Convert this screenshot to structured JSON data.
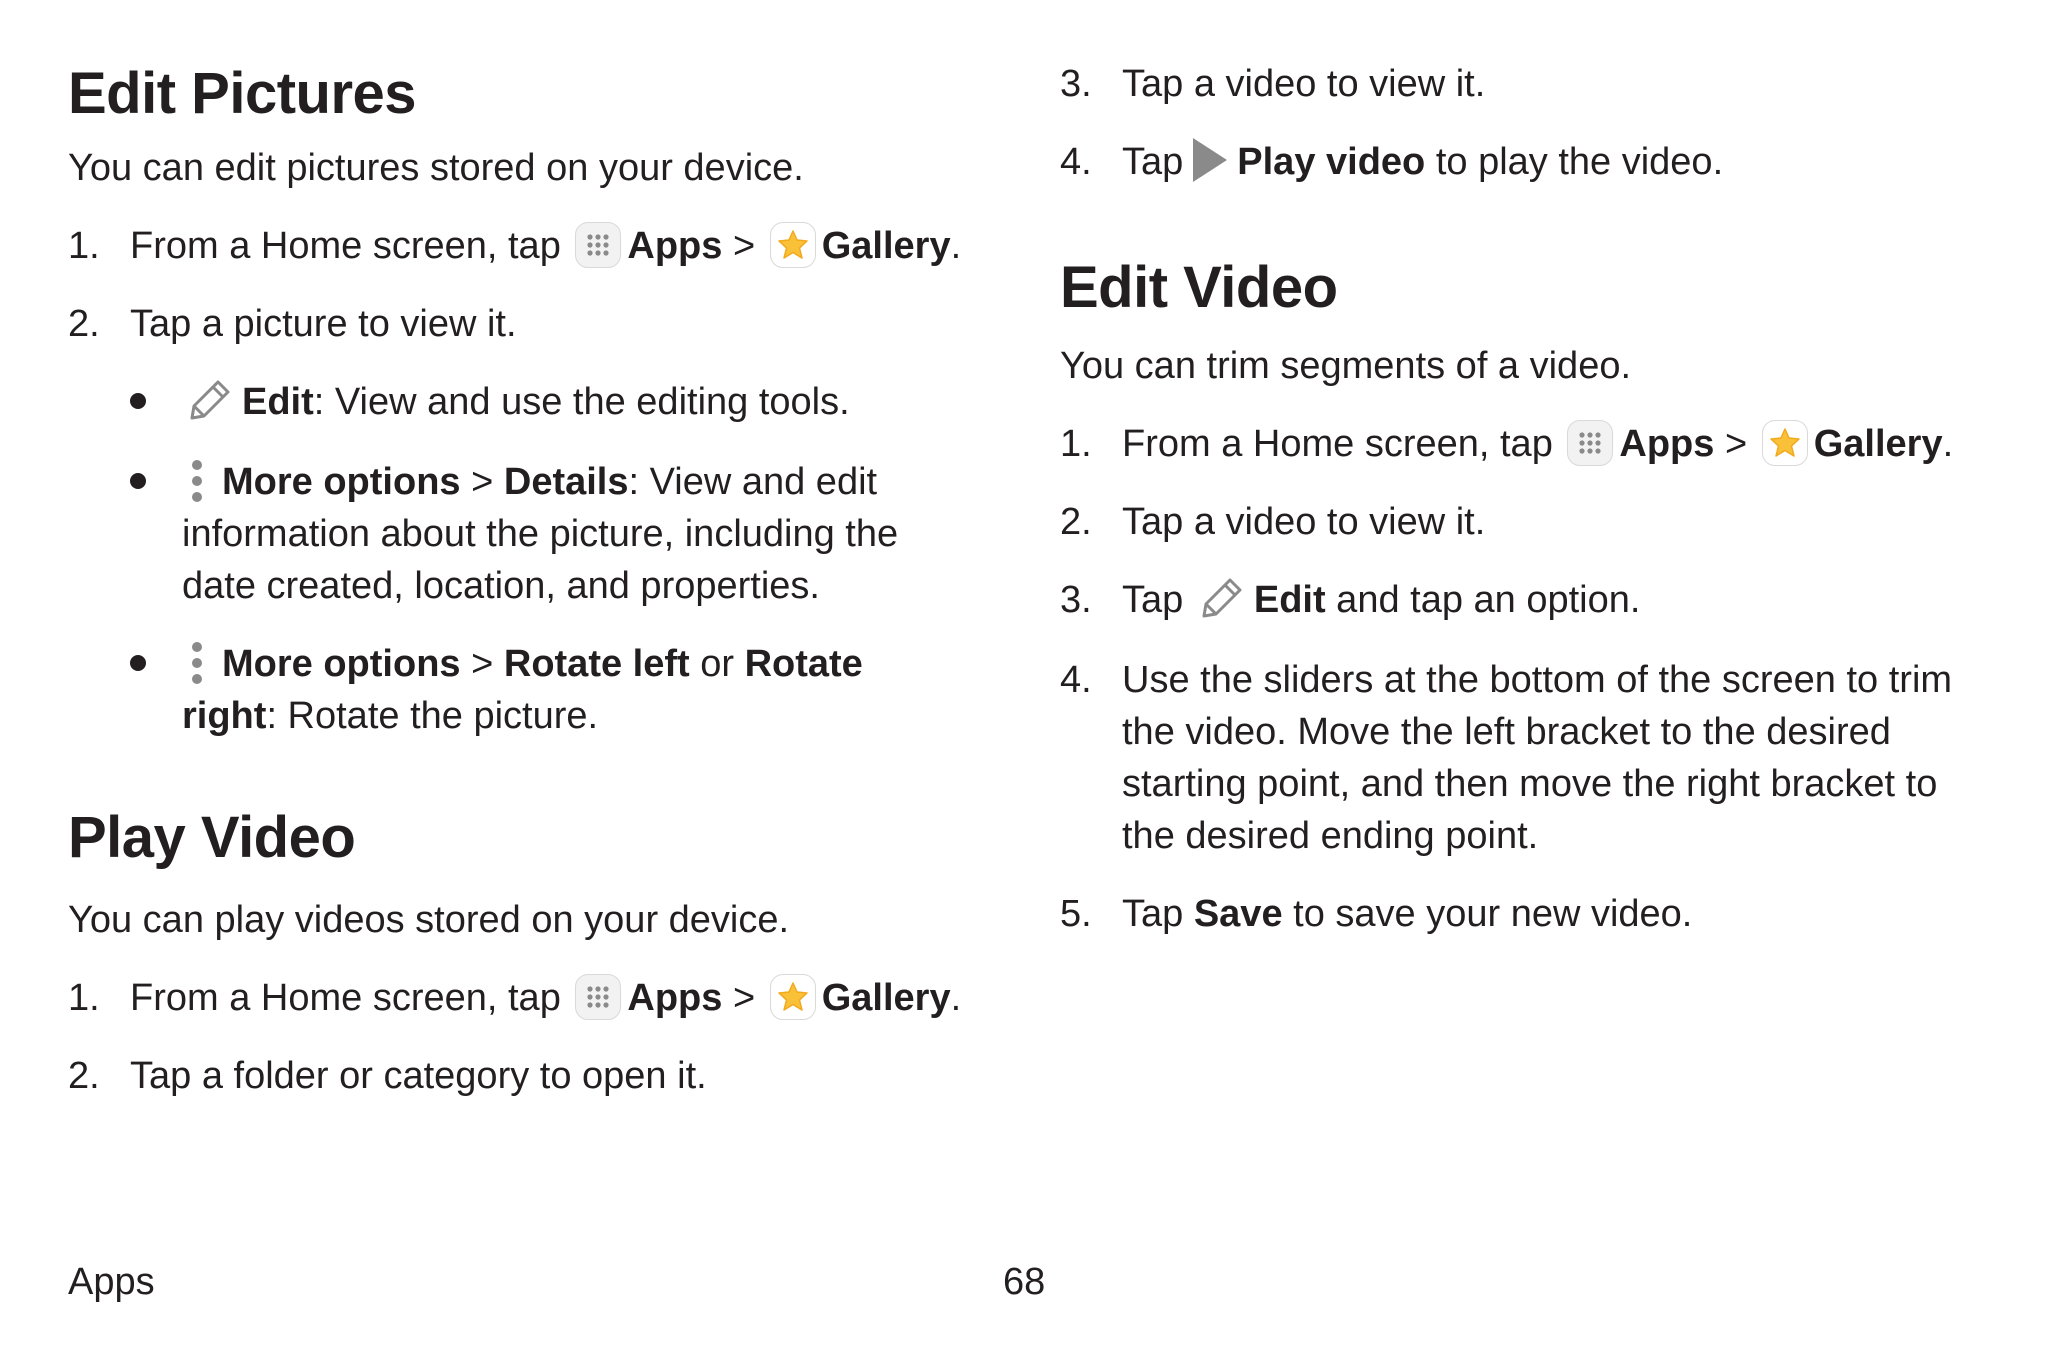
{
  "edit_pictures": {
    "title": "Edit Pictures",
    "intro": "You can edit pictures stored on your device.",
    "step1": {
      "num": "1.",
      "text": "From a Home screen, tap",
      "apps": "Apps",
      "sep": ">",
      "gallery": "Gallery",
      "end": "."
    },
    "step2": {
      "num": "2.",
      "text": "Tap a picture to view it."
    },
    "bullet_edit": {
      "label": "Edit",
      "text": ": View and use the editing tools."
    },
    "bullet_details": {
      "more": "More options",
      "sep": ">",
      "label": "Details",
      "text": ": View and edit information about the picture, including the date created, location, and properties."
    },
    "bullet_rotate": {
      "more": "More options",
      "sep": ">",
      "left": "Rotate left",
      "or": " or ",
      "right": "Rotate right",
      "text": ": Rotate the picture."
    }
  },
  "play_video": {
    "title": "Play Video",
    "intro": "You can play videos stored on your device.",
    "step1": {
      "num": "1.",
      "text": "From a Home screen, tap",
      "apps": "Apps",
      "sep": ">",
      "gallery": "Gallery",
      "end": "."
    },
    "step2": {
      "num": "2.",
      "text": "Tap a folder or category to open it."
    },
    "step3": {
      "num": "3.",
      "text": "Tap a video to view it."
    },
    "step4": {
      "num": "4.",
      "pre": "Tap",
      "label": "Play video",
      "text": " to play the video."
    }
  },
  "edit_video": {
    "title": "Edit Video",
    "intro": "You can trim segments of a video.",
    "step1": {
      "num": "1.",
      "text": "From a Home screen, tap",
      "apps": "Apps",
      "sep": ">",
      "gallery": "Gallery",
      "end": "."
    },
    "step2": {
      "num": "2.",
      "text": "Tap a video to view it."
    },
    "step3": {
      "num": "3.",
      "pre": "Tap",
      "label": "Edit",
      "text": " and tap an option."
    },
    "step4": {
      "num": "4.",
      "text": "Use the sliders at the bottom of the screen to trim the video. Move the left bracket to the desired starting point, and then move the right bracket to the desired ending point."
    },
    "step5": {
      "num": "5.",
      "pre": "Tap ",
      "label": "Save",
      "text": " to save your new video."
    }
  },
  "footer": {
    "section": "Apps",
    "page": "68"
  },
  "icons": {
    "apps": "apps-grid-icon",
    "gallery": "gallery-flower-icon",
    "edit": "pencil-icon",
    "more": "more-options-vertical-dots-icon",
    "play": "play-triangle-icon"
  },
  "colors": {
    "text": "#231f20",
    "icon_gray": "#8a8a8a",
    "gallery_yellow": "#f9c138"
  }
}
